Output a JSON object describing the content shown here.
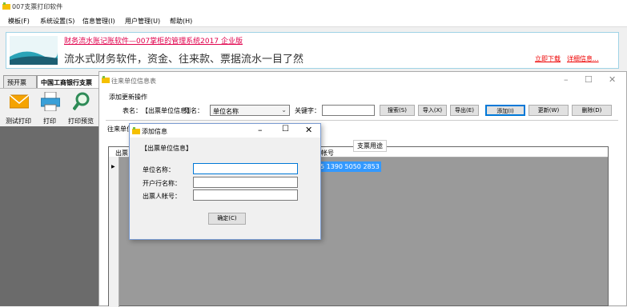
{
  "app": {
    "title": "007支票打印软件"
  },
  "menu": [
    "模板(F)",
    "系统设置(S)",
    "信息管理(I)",
    "用户管理(U)",
    "帮助(H)"
  ],
  "banner": {
    "line1": "财务流水账记账软件—007掌柜的管理系统2017 企业版",
    "line2": "流水式财务软件，资金、往来款、票据流水一目了然",
    "link_download": "立即下载",
    "link_details": "详细信息..."
  },
  "tabs": [
    "预开票",
    "中国工商银行支票"
  ],
  "toolbar": {
    "test_print": "测试打印",
    "print": "打印",
    "print_preview": "打印预览"
  },
  "win_main": {
    "title": "往来单位信息表",
    "section": "添加更新操作",
    "table_label": "表名：",
    "table_name": "【出票单位信息】",
    "col_label": "列名：",
    "col_value": "单位名称",
    "keyword_label": "关键字：",
    "buttons": [
      "搜索(S)",
      "导入(X)",
      "导出(E)",
      "添加(I)",
      "更新(W)",
      "删除(D)"
    ],
    "list_label": "往来单位",
    "grid_col_left": "出票",
    "grid_headers": [
      "帐号",
      "支票用途"
    ],
    "grid_row_account": "5 1390 5050 2853"
  },
  "dialog": {
    "title": "添加信息",
    "heading": "【出票单位信息】",
    "fields": [
      {
        "label": "单位名称：",
        "value": ""
      },
      {
        "label": "开户行名称：",
        "value": ""
      },
      {
        "label": "出票人帐号：",
        "value": ""
      }
    ],
    "ok": "确定(C)"
  },
  "colors": {
    "accent": "#0078d7",
    "link": "#e00000",
    "banner_title": "#e0004c"
  }
}
